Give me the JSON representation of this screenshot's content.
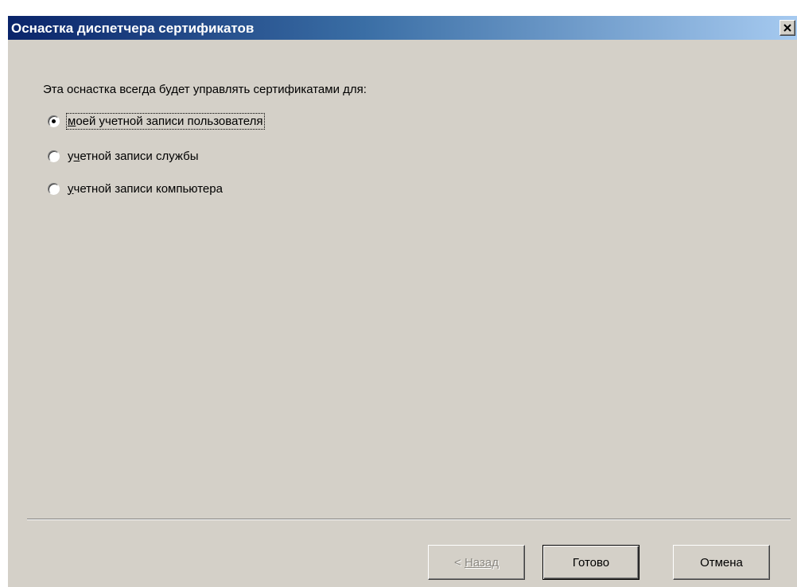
{
  "window": {
    "title": "Оснастка диспетчера сертификатов"
  },
  "dialog": {
    "prompt": "Эта оснастка всегда будет управлять сертификатами для:",
    "options": [
      {
        "pre": "",
        "accel": "м",
        "post": "оей учетной записи пользователя",
        "checked": true
      },
      {
        "pre": "у",
        "accel": "ч",
        "post": "етной записи службы",
        "checked": false
      },
      {
        "pre": "",
        "accel": "у",
        "post": "четной записи компьютера",
        "checked": false
      }
    ]
  },
  "buttons": {
    "back_prefix": "< ",
    "back_label": "Назад",
    "back_enabled": false,
    "finish_label": "Готово",
    "cancel_label": "Отмена"
  },
  "colors": {
    "titlebar_start": "#0a246a",
    "titlebar_end": "#a6caf0",
    "window_bg": "#d4d0c8"
  }
}
